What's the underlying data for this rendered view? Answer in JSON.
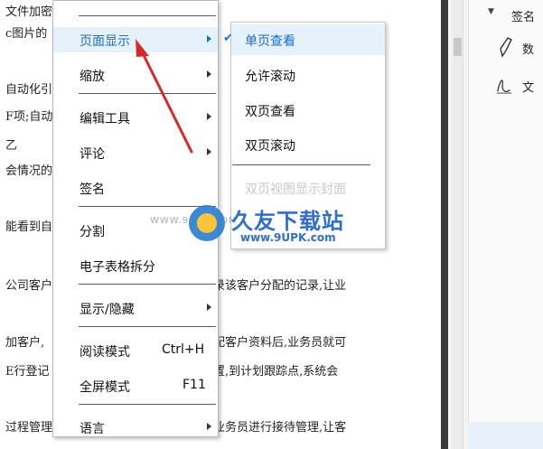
{
  "document": {
    "lines": [
      {
        "text": "文件加密"
      },
      {
        "text": "c图片的"
      },
      {
        "text": "自动化引"
      },
      {
        "text": "F项;自动"
      },
      {
        "text": "乙"
      },
      {
        "text": "会情况的"
      },
      {
        "text": "能看到自"
      },
      {
        "text": "公司客户"
      },
      {
        "text": "加客户,"
      },
      {
        "text": "E行登记"
      },
      {
        "text": "过程管理"
      }
    ],
    "right_lines": [
      {
        "text": "录该客户分配的记录,让业"
      },
      {
        "text": "配客户资料后,业务员就可"
      },
      {
        "text": "置,到计划跟踪点,系统会"
      },
      {
        "text": "业务员进行接待管理,让客"
      }
    ]
  },
  "right_panel": {
    "header": "签名",
    "items": [
      {
        "label": "数",
        "icon": "pen-icon"
      },
      {
        "label": "文",
        "icon": "signature-icon"
      }
    ]
  },
  "context_menu": {
    "items": [
      {
        "label": "页面显示",
        "has_submenu": true,
        "highlighted": true
      },
      {
        "label": "缩放",
        "has_submenu": true
      },
      {
        "label": "编辑工具",
        "has_submenu": true
      },
      {
        "label": "评论",
        "has_submenu": true
      },
      {
        "label": "签名"
      },
      {
        "label": "分割"
      },
      {
        "label": "电子表格拆分"
      },
      {
        "label": "显示/隐藏",
        "has_submenu": true
      },
      {
        "label": "阅读模式",
        "shortcut": "Ctrl+H"
      },
      {
        "label": "全屏模式",
        "shortcut": "F11"
      },
      {
        "label": "语言",
        "has_submenu": true
      }
    ]
  },
  "submenu": {
    "items": [
      {
        "label": "单页查看",
        "checked": true
      },
      {
        "label": "允许滚动"
      },
      {
        "label": "双页查看"
      },
      {
        "label": "双页滚动"
      },
      {
        "label": "双页视图显示封面",
        "disabled": true
      }
    ]
  },
  "watermark": {
    "url_left": "WWW.9UPK.COM",
    "brand": "久友下载站",
    "url": "www.9UPK.com"
  },
  "colors": {
    "accent": "#1a6fc9",
    "highlight_bg": "#e5f1fb",
    "arrow": "#d42a2a"
  }
}
